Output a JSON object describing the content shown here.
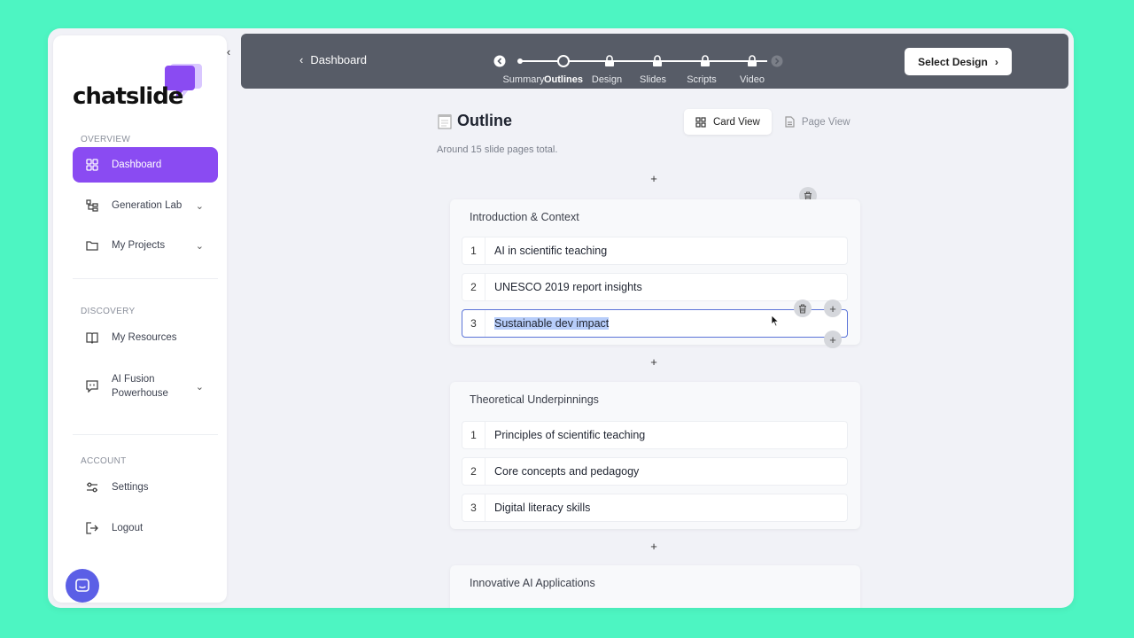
{
  "sidebar": {
    "logo_text": "chatslide",
    "sections": {
      "overview": "OVERVIEW",
      "discovery": "DISCOVERY",
      "account": "ACCOUNT"
    },
    "items": {
      "dashboard": "Dashboard",
      "generation_lab": "Generation Lab",
      "my_projects": "My Projects",
      "my_resources": "My Resources",
      "ai_fusion_line1": "AI Fusion",
      "ai_fusion_line2": "Powerhouse",
      "settings": "Settings",
      "logout": "Logout"
    }
  },
  "header": {
    "back_label": "Dashboard",
    "steps": [
      "Summary",
      "Outlines",
      "Design",
      "Slides",
      "Scripts",
      "Video"
    ],
    "current_step": "Outlines",
    "select_design_label": "Select Design"
  },
  "main": {
    "title": "Outline",
    "subtitle": "Around 15 slide pages total.",
    "views": {
      "card": "Card View",
      "page": "Page View"
    },
    "sections": [
      {
        "title": "Introduction & Context",
        "items": [
          {
            "num": "1",
            "text": "AI in scientific teaching"
          },
          {
            "num": "2",
            "text": "UNESCO 2019 report insights"
          },
          {
            "num": "3",
            "text": "Sustainable dev impact"
          }
        ]
      },
      {
        "title": "Theoretical Underpinnings",
        "items": [
          {
            "num": "1",
            "text": "Principles of scientific teaching"
          },
          {
            "num": "2",
            "text": "Core concepts and pedagogy"
          },
          {
            "num": "3",
            "text": "Digital literacy skills"
          }
        ]
      },
      {
        "title": "Innovative AI Applications",
        "items": []
      }
    ],
    "plus": "+"
  },
  "colors": {
    "accent": "#8a4bf2",
    "background": "#4df5c2",
    "topbar": "#575c67",
    "selection": "#b7cdfa"
  }
}
